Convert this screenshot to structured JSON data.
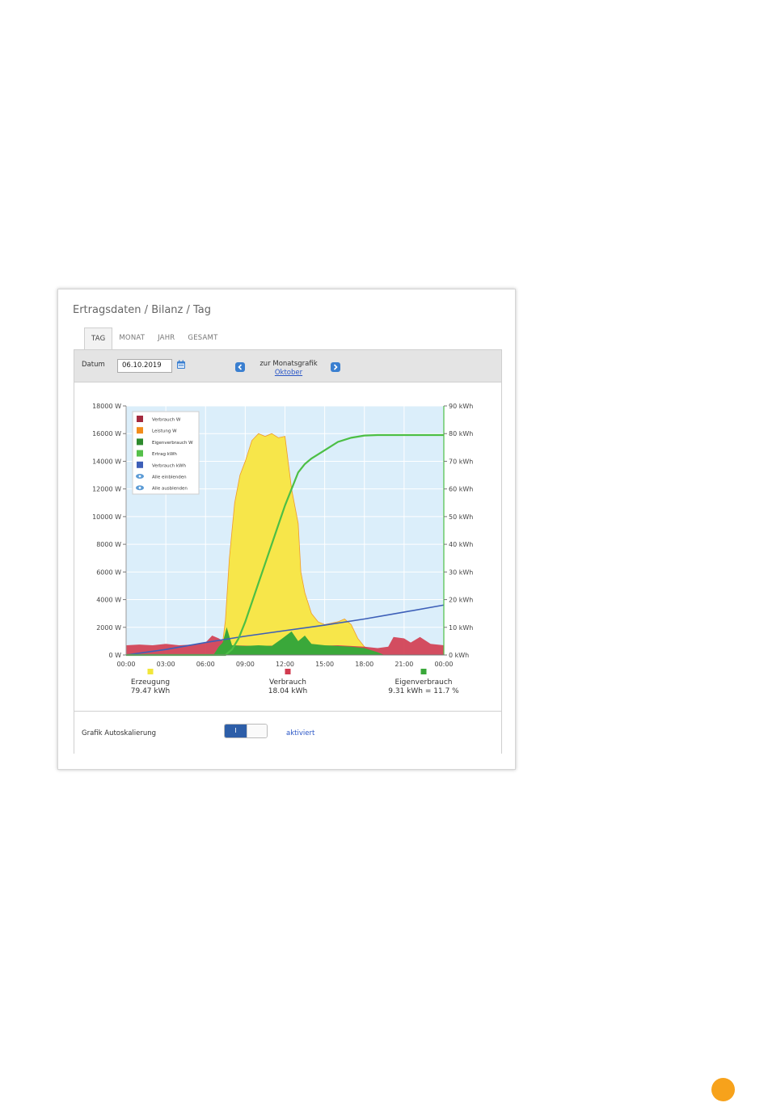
{
  "panel": {
    "breadcrumb": "Ertragsdaten / Bilanz / Tag",
    "tabs": [
      {
        "label": "TAG",
        "active": true
      },
      {
        "label": "MONAT",
        "active": false
      },
      {
        "label": "JAHR",
        "active": false
      },
      {
        "label": "GESAMT",
        "active": false
      }
    ]
  },
  "toolbar": {
    "date_label": "Datum",
    "date_value": "06.10.2019",
    "month_caption": "zur Monatsgrafik",
    "month_link": "Oktober"
  },
  "chart_data": {
    "type": "area",
    "x_ticks": [
      "00:00",
      "03:00",
      "06:00",
      "09:00",
      "12:00",
      "15:00",
      "18:00",
      "21:00",
      "00:00"
    ],
    "x_range_hours": [
      0,
      24
    ],
    "y_left": {
      "unit": "W",
      "ticks": [
        "0 W",
        "2000 W",
        "4000 W",
        "6000 W",
        "8000 W",
        "10000 W",
        "12000 W",
        "14000 W",
        "16000 W",
        "18000 W"
      ],
      "range": [
        0,
        18000
      ]
    },
    "y_right": {
      "unit": "kWh",
      "ticks": [
        "0 kWh",
        "10 kWh",
        "20 kWh",
        "30 kWh",
        "40 kWh",
        "50 kWh",
        "60 kWh",
        "70 kWh",
        "80 kWh",
        "90 kWh"
      ],
      "range": [
        0,
        90
      ]
    },
    "grid": true,
    "legend_position": "top-left",
    "legend": [
      {
        "label": "Verbrauch W",
        "color": "#a42a3e"
      },
      {
        "label": "Leistung W",
        "color": "#f28c1a"
      },
      {
        "label": "Eigenverbrauch W",
        "color": "#2d8a2d"
      },
      {
        "label": "Ertrag kWh",
        "color": "#55c04a"
      },
      {
        "label": "Verbrauch kWh",
        "color": "#3d5fb8"
      },
      {
        "label": "Alle einblenden",
        "icon": "eye-icon"
      },
      {
        "label": "Alle ausblenden",
        "icon": "eye-slash-icon"
      }
    ],
    "series": [
      {
        "name": "Leistung W",
        "axis": "left",
        "color": "#f7e64a",
        "x": [
          0,
          6.8,
          7.2,
          7.5,
          7.8,
          8.2,
          8.6,
          9.0,
          9.5,
          10.0,
          10.5,
          11.0,
          11.5,
          12.0,
          12.5,
          13.0,
          13.2,
          13.5,
          14.0,
          14.5,
          15.0,
          15.5,
          16.0,
          16.5,
          17.0,
          17.5,
          18.0,
          18.5,
          19.5,
          24
        ],
        "y": [
          0,
          0,
          200,
          2500,
          7000,
          11000,
          13000,
          14000,
          15500,
          16000,
          15800,
          16000,
          15700,
          15800,
          12000,
          9500,
          6000,
          4500,
          3000,
          2400,
          2200,
          2300,
          2400,
          2600,
          2200,
          1200,
          600,
          300,
          0,
          0
        ]
      },
      {
        "name": "Verbrauch W",
        "axis": "left",
        "color": "#d23b4f",
        "x": [
          0,
          1,
          2,
          3,
          4,
          5,
          6,
          6.5,
          7.0,
          7.5,
          8.0,
          10,
          12,
          14,
          16,
          18,
          19,
          19.8,
          20.2,
          21.0,
          21.5,
          22.2,
          23,
          24
        ],
        "y": [
          700,
          750,
          700,
          800,
          700,
          750,
          900,
          1400,
          1200,
          900,
          700,
          650,
          700,
          650,
          700,
          600,
          500,
          600,
          1300,
          1200,
          900,
          1300,
          800,
          700
        ]
      },
      {
        "name": "Eigenverbrauch W",
        "axis": "left",
        "color": "#3aa83a",
        "x": [
          0,
          6.6,
          7.0,
          7.3,
          7.6,
          8.0,
          9.0,
          10.0,
          11.0,
          11.8,
          12.5,
          13.0,
          13.5,
          14.0,
          15.0,
          16.0,
          17.0,
          18.0,
          19.0,
          19.5,
          24
        ],
        "y": [
          0,
          0,
          600,
          900,
          2000,
          700,
          650,
          700,
          650,
          1200,
          1700,
          1000,
          1400,
          800,
          700,
          650,
          600,
          500,
          200,
          0,
          0
        ]
      },
      {
        "name": "Ertrag kWh",
        "axis": "right",
        "color": "#4cbf45",
        "x": [
          0,
          7.5,
          8.0,
          8.5,
          9.0,
          9.5,
          10.0,
          10.5,
          11.0,
          11.5,
          12.0,
          12.5,
          13.0,
          13.5,
          14.0,
          15.0,
          16.0,
          17.0,
          18.0,
          19.0,
          24
        ],
        "y": [
          0,
          0,
          2,
          6,
          12,
          19,
          26,
          33,
          40,
          47,
          54,
          60,
          66,
          69,
          71,
          74,
          77,
          78.5,
          79.3,
          79.47,
          79.47
        ]
      },
      {
        "name": "Verbrauch kWh",
        "axis": "right",
        "color": "#3d5fb8",
        "x": [
          0,
          3,
          6,
          9,
          12,
          15,
          18,
          21,
          24
        ],
        "y": [
          0,
          2,
          4.5,
          6.8,
          8.8,
          10.8,
          13,
          15.5,
          18.04
        ]
      }
    ],
    "totals": [
      {
        "label": "Erzeugung",
        "value": "79.47 kWh",
        "color": "#f2e63a"
      },
      {
        "label": "Verbrauch",
        "value": "18.04 kWh",
        "color": "#d23b4f"
      },
      {
        "label": "Eigenverbrauch",
        "value": "9.31 kWh = 11.7 %",
        "color": "#3aa83a"
      }
    ]
  },
  "autoscale": {
    "label": "Grafik Autoskalierung",
    "toggle_on_text": "I",
    "state": "aktiviert"
  }
}
